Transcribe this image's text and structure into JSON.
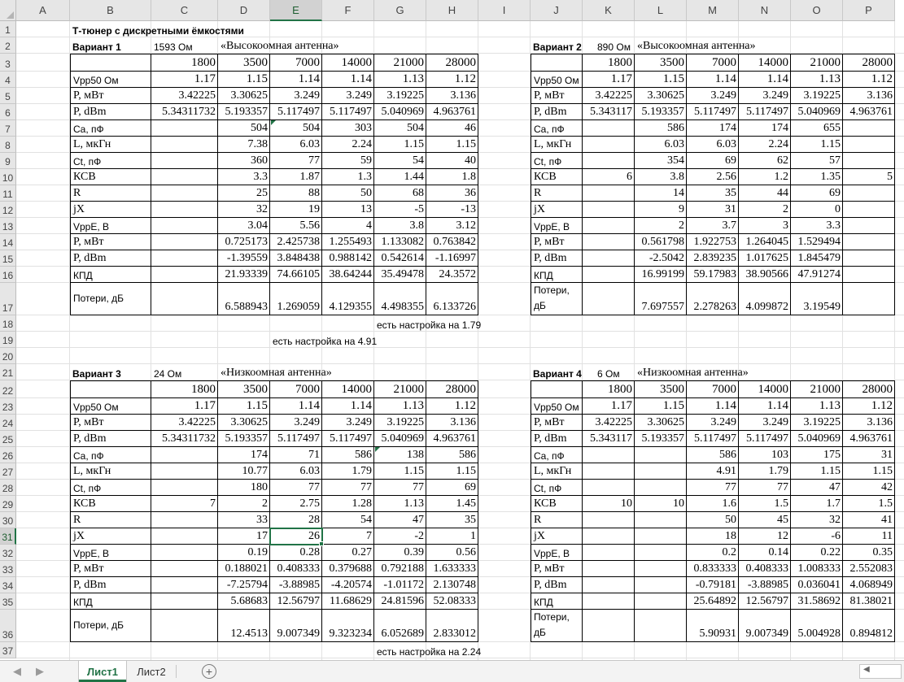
{
  "columns": [
    "A",
    "B",
    "C",
    "D",
    "E",
    "F",
    "G",
    "H",
    "I",
    "J",
    "K",
    "L",
    "M",
    "N",
    "O",
    "P"
  ],
  "rows": [
    "1",
    "2",
    "3",
    "4",
    "5",
    "6",
    "7",
    "8",
    "9",
    "10",
    "11",
    "12",
    "13",
    "14",
    "15",
    "16",
    "17",
    "18",
    "19",
    "20",
    "21",
    "22",
    "23",
    "24",
    "25",
    "26",
    "27",
    "28",
    "29",
    "30",
    "31",
    "32",
    "33",
    "34",
    "35",
    "36",
    "37"
  ],
  "selected_cell": "E31",
  "title": "Т-тюнер с дискретными ёмкостями",
  "variant1": {
    "label": "Вариант 1",
    "impedance": "1593 Ом",
    "antenna": "«Высокоомная антенна»",
    "freqs": [
      "1800",
      "3500",
      "7000",
      "14000",
      "21000",
      "28000"
    ],
    "rows": [
      [
        "Vpp50 Ом",
        "1.17",
        "1.15",
        "1.14",
        "1.14",
        "1.13",
        "1.12"
      ],
      [
        "P, мВт",
        "3.42225",
        "3.30625",
        "3.249",
        "3.249",
        "3.19225",
        "3.136"
      ],
      [
        "P, dBm",
        "5.34311732",
        "5.193357",
        "5.117497",
        "5.117497",
        "5.040969",
        "4.963761"
      ],
      [
        "Ca, пФ",
        "",
        "504",
        "504",
        "303",
        "504",
        "46"
      ],
      [
        "L, мкГн",
        "",
        "7.38",
        "6.03",
        "2.24",
        "1.15",
        "1.15"
      ],
      [
        "Ct, пФ",
        "",
        "360",
        "77",
        "59",
        "54",
        "40"
      ],
      [
        "КСВ",
        "",
        "3.3",
        "1.87",
        "1.3",
        "1.44",
        "1.8"
      ],
      [
        "R",
        "",
        "25",
        "88",
        "50",
        "68",
        "36"
      ],
      [
        "jX",
        "",
        "32",
        "19",
        "13",
        "-5",
        "-13"
      ],
      [
        "VppE, В",
        "",
        "3.04",
        "5.56",
        "4",
        "3.8",
        "3.12"
      ],
      [
        "P, мВт",
        "",
        "0.725173",
        "2.425738",
        "1.255493",
        "1.133082",
        "0.763842"
      ],
      [
        "P, dBm",
        "",
        "-1.39559",
        "3.848438",
        "0.988142",
        "0.542614",
        "-1.16997"
      ],
      [
        "КПД",
        "",
        "21.93339",
        "74.66105",
        "38.64244",
        "35.49478",
        "24.3572"
      ],
      [
        "Потери, дБ",
        "",
        "6.588943",
        "1.269059",
        "4.129355",
        "4.498355",
        "6.133726"
      ]
    ]
  },
  "variant2": {
    "label": "Вариант 2",
    "impedance": "890 Ом",
    "antenna": "«Высокоомная антенна»",
    "freqs": [
      "1800",
      "3500",
      "7000",
      "14000",
      "21000",
      "28000"
    ],
    "rows": [
      [
        "Vpp50 Ом",
        "1.17",
        "1.15",
        "1.14",
        "1.14",
        "1.13",
        "1.12"
      ],
      [
        "P, мВт",
        "3.42225",
        "3.30625",
        "3.249",
        "3.249",
        "3.19225",
        "3.136"
      ],
      [
        "P, dBm",
        "5.343117",
        "5.193357",
        "5.117497",
        "5.117497",
        "5.040969",
        "4.963761"
      ],
      [
        "Ca, пФ",
        "",
        "586",
        "174",
        "174",
        "655",
        ""
      ],
      [
        "L, мкГн",
        "",
        "6.03",
        "6.03",
        "2.24",
        "1.15",
        ""
      ],
      [
        "Ct, пФ",
        "",
        "354",
        "69",
        "62",
        "57",
        ""
      ],
      [
        "КСВ",
        "6",
        "3.8",
        "2.56",
        "1.2",
        "1.35",
        "5"
      ],
      [
        "R",
        "",
        "14",
        "35",
        "44",
        "69",
        ""
      ],
      [
        "jX",
        "",
        "9",
        "31",
        "2",
        "0",
        ""
      ],
      [
        "VppE, В",
        "",
        "2",
        "3.7",
        "3",
        "3.3",
        ""
      ],
      [
        "P, мВт",
        "",
        "0.561798",
        "1.922753",
        "1.264045",
        "1.529494",
        ""
      ],
      [
        "P, dBm",
        "",
        "-2.5042",
        "2.839235",
        "1.017625",
        "1.845479",
        ""
      ],
      [
        "КПД",
        "",
        "16.99199",
        "59.17983",
        "38.90566",
        "47.91274",
        ""
      ],
      [
        "Потери, дБ",
        "",
        "7.697557",
        "2.278263",
        "4.099872",
        "3.19549",
        ""
      ]
    ]
  },
  "variant3": {
    "label": "Вариант 3",
    "impedance": "24 Ом",
    "antenna": "«Низкоомная антенна»",
    "freqs": [
      "1800",
      "3500",
      "7000",
      "14000",
      "21000",
      "28000"
    ],
    "rows": [
      [
        "Vpp50 Ом",
        "1.17",
        "1.15",
        "1.14",
        "1.14",
        "1.13",
        "1.12"
      ],
      [
        "P, мВт",
        "3.42225",
        "3.30625",
        "3.249",
        "3.249",
        "3.19225",
        "3.136"
      ],
      [
        "P, dBm",
        "5.34311732",
        "5.193357",
        "5.117497",
        "5.117497",
        "5.040969",
        "4.963761"
      ],
      [
        "Ca, пФ",
        "",
        "174",
        "71",
        "586",
        "138",
        "586"
      ],
      [
        "L, мкГн",
        "",
        "10.77",
        "6.03",
        "1.79",
        "1.15",
        "1.15"
      ],
      [
        "Ct, пФ",
        "",
        "180",
        "77",
        "77",
        "77",
        "69"
      ],
      [
        "КСВ",
        "7",
        "2",
        "2.75",
        "1.28",
        "1.13",
        "1.45"
      ],
      [
        "R",
        "",
        "33",
        "28",
        "54",
        "47",
        "35"
      ],
      [
        "jX",
        "",
        "17",
        "26",
        "7",
        "-2",
        "1"
      ],
      [
        "VppE, В",
        "",
        "0.19",
        "0.28",
        "0.27",
        "0.39",
        "0.56"
      ],
      [
        "P, мВт",
        "",
        "0.188021",
        "0.408333",
        "0.379688",
        "0.792188",
        "1.633333"
      ],
      [
        "P, dBm",
        "",
        "-7.25794",
        "-3.88985",
        "-4.20574",
        "-1.01172",
        "2.130748"
      ],
      [
        "КПД",
        "",
        "5.68683",
        "12.56797",
        "11.68629",
        "24.81596",
        "52.08333"
      ],
      [
        "Потери, дБ",
        "",
        "12.4513",
        "9.007349",
        "9.323234",
        "6.052689",
        "2.833012"
      ]
    ]
  },
  "variant4": {
    "label": "Вариант 4",
    "impedance": "6 Ом",
    "antenna": "«Низкоомная антенна»",
    "freqs": [
      "1800",
      "3500",
      "7000",
      "14000",
      "21000",
      "28000"
    ],
    "rows": [
      [
        "Vpp50 Ом",
        "1.17",
        "1.15",
        "1.14",
        "1.14",
        "1.13",
        "1.12"
      ],
      [
        "P, мВт",
        "3.42225",
        "3.30625",
        "3.249",
        "3.249",
        "3.19225",
        "3.136"
      ],
      [
        "P, dBm",
        "5.343117",
        "5.193357",
        "5.117497",
        "5.117497",
        "5.040969",
        "4.963761"
      ],
      [
        "Ca, пФ",
        "",
        "",
        "586",
        "103",
        "175",
        "31"
      ],
      [
        "L, мкГн",
        "",
        "",
        "4.91",
        "1.79",
        "1.15",
        "1.15"
      ],
      [
        "Ct, пФ",
        "",
        "",
        "77",
        "77",
        "47",
        "42"
      ],
      [
        "КСВ",
        "10",
        "10",
        "1.6",
        "1.5",
        "1.7",
        "1.5"
      ],
      [
        "R",
        "",
        "",
        "50",
        "45",
        "32",
        "41"
      ],
      [
        "jX",
        "",
        "",
        "18",
        "12",
        "-6",
        "11"
      ],
      [
        "VppE, В",
        "",
        "",
        "0.2",
        "0.14",
        "0.22",
        "0.35"
      ],
      [
        "P, мВт",
        "",
        "",
        "0.833333",
        "0.408333",
        "1.008333",
        "2.552083"
      ],
      [
        "P, dBm",
        "",
        "",
        "-0.79181",
        "-3.88985",
        "0.036041",
        "4.068949"
      ],
      [
        "КПД",
        "",
        "",
        "25.64892",
        "12.56797",
        "31.58692",
        "81.38021"
      ],
      [
        "Потери, дБ",
        "",
        "",
        "5.90931",
        "9.007349",
        "5.004928",
        "0.894812"
      ]
    ]
  },
  "notes": {
    "r18": "есть настройка на 1.79",
    "r19": "есть настройка на 4.91",
    "r37": "есть настройка на 2.24"
  },
  "tabs": {
    "sheet1": "Лист1",
    "sheet2": "Лист2",
    "nav_prev": "◀",
    "nav_next": "▶",
    "add": "+"
  },
  "colors": {
    "accent": "#217346",
    "grid": "#e1e1e1",
    "header_bg": "#e6e6e6"
  }
}
